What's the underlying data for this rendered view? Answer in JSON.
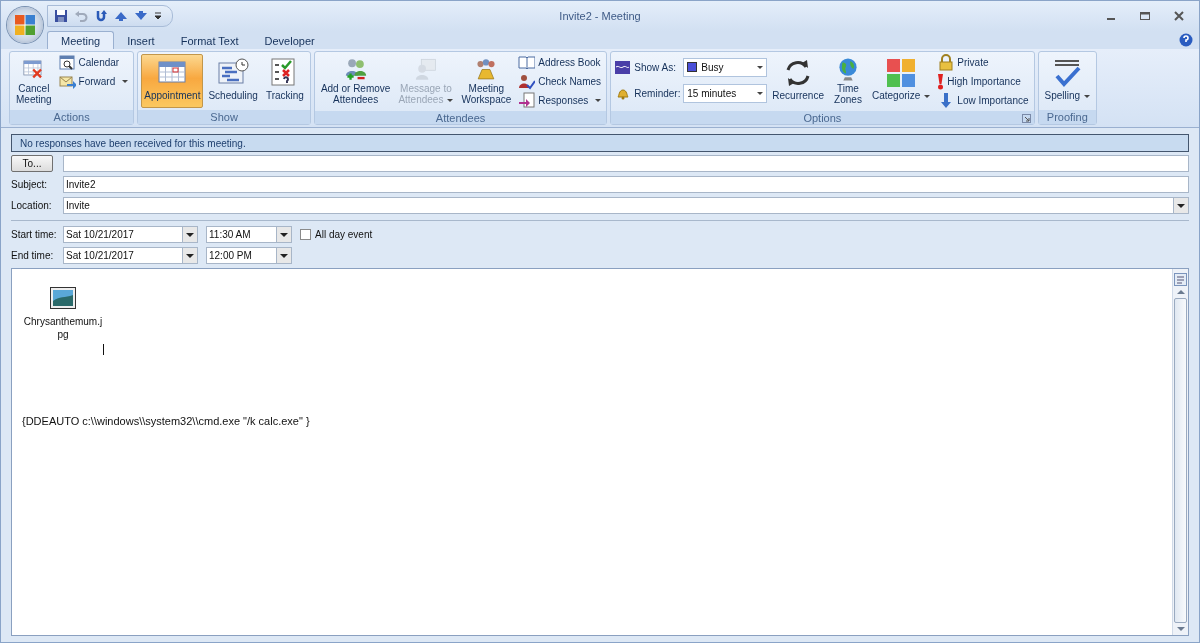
{
  "window": {
    "title": "Invite2 - Meeting"
  },
  "tabs": [
    {
      "label": "Meeting",
      "selected": true
    },
    {
      "label": "Insert",
      "selected": false
    },
    {
      "label": "Format Text",
      "selected": false
    },
    {
      "label": "Developer",
      "selected": false
    }
  ],
  "ribbon": {
    "groups": [
      {
        "label": "Actions",
        "launcher": false,
        "columns": [
          [
            {
              "kind": "large",
              "label": "Cancel\nMeeting",
              "selected": false,
              "disabled": false,
              "dropdown": false
            }
          ],
          [
            {
              "kind": "small",
              "label": "Calendar",
              "dropdown": false
            },
            {
              "kind": "small",
              "label": "Forward",
              "dropdown": true
            }
          ]
        ]
      },
      {
        "label": "Show",
        "launcher": false,
        "columns": [
          [
            {
              "kind": "large",
              "label": "Appointment",
              "selected": true,
              "disabled": false,
              "dropdown": false
            }
          ],
          [
            {
              "kind": "large",
              "label": "Scheduling",
              "selected": false,
              "disabled": false,
              "dropdown": false
            }
          ],
          [
            {
              "kind": "large",
              "label": "Tracking",
              "selected": false,
              "disabled": false,
              "dropdown": false
            }
          ]
        ]
      },
      {
        "label": "Attendees",
        "launcher": false,
        "columns": [
          [
            {
              "kind": "large",
              "label": "Add or Remove\nAttendees",
              "selected": false,
              "disabled": false,
              "dropdown": false
            }
          ],
          [
            {
              "kind": "large",
              "label": "Message to\nAttendees",
              "selected": false,
              "disabled": true,
              "dropdown": true
            }
          ],
          [
            {
              "kind": "large",
              "label": "Meeting\nWorkspace",
              "selected": false,
              "disabled": false,
              "dropdown": false
            }
          ],
          [
            {
              "kind": "small",
              "label": "Address Book",
              "dropdown": false
            },
            {
              "kind": "small",
              "label": "Check Names",
              "dropdown": false
            },
            {
              "kind": "small",
              "label": "Responses",
              "dropdown": true
            }
          ]
        ]
      },
      {
        "label": "Options",
        "launcher": true,
        "columns": [
          [
            {
              "kind": "combo",
              "label": "Show As:",
              "value": "Busy",
              "color": "#4a4fd8"
            },
            {
              "kind": "combo",
              "label": "Reminder:",
              "value": "15 minutes"
            }
          ],
          [
            {
              "kind": "large",
              "label": "Recurrence",
              "selected": false,
              "disabled": false,
              "dropdown": false
            }
          ],
          [
            {
              "kind": "large",
              "label": "Time\nZones",
              "selected": false,
              "disabled": false,
              "dropdown": false
            }
          ],
          [
            {
              "kind": "large",
              "label": "Categorize",
              "selected": false,
              "disabled": false,
              "dropdown": true
            }
          ],
          [
            {
              "kind": "small",
              "label": "Private",
              "dropdown": false
            },
            {
              "kind": "small",
              "label": "High Importance",
              "dropdown": false
            },
            {
              "kind": "small",
              "label": "Low Importance",
              "dropdown": false
            }
          ]
        ]
      },
      {
        "label": "Proofing",
        "launcher": false,
        "columns": [
          [
            {
              "kind": "large",
              "label": "Spelling",
              "selected": false,
              "disabled": false,
              "dropdown": true
            }
          ]
        ]
      }
    ]
  },
  "info_bar": "No responses have been received for this meeting.",
  "form": {
    "to_button": "To...",
    "subject_label": "Subject:",
    "subject": "Invite2",
    "location_label": "Location:",
    "location": "Invite",
    "start_label": "Start time:",
    "start_date": "Sat 10/21/2017",
    "start_time": "11:30 AM",
    "all_day": {
      "label": "All day event",
      "checked": false
    },
    "end_label": "End time:",
    "end_date": "Sat 10/21/2017",
    "end_time": "12:00 PM"
  },
  "body": {
    "attachment": "Chrysanthemum.j\npg",
    "text": "{DDEAUTO c:\\\\windows\\\\system32\\\\cmd.exe \"/k calc.exe\" }"
  }
}
